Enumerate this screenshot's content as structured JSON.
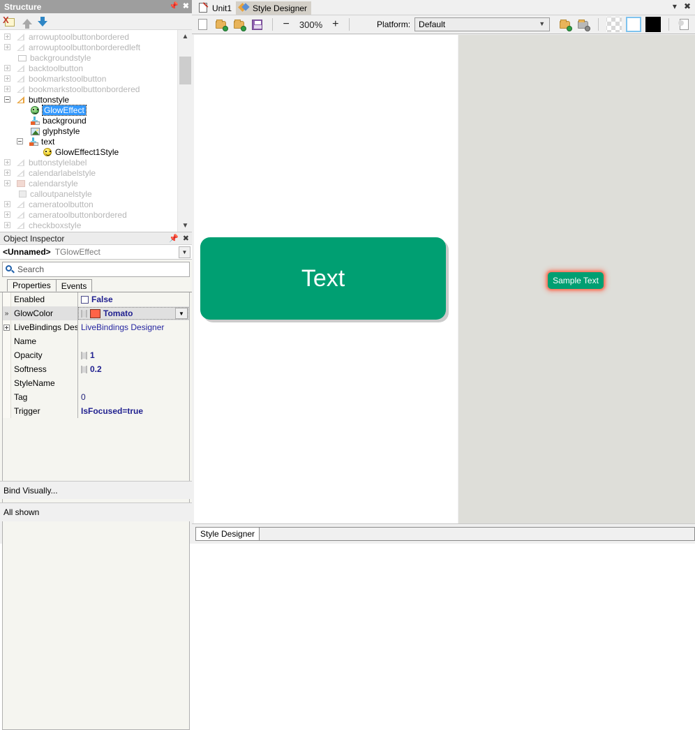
{
  "structure_panel": {
    "title": "Structure",
    "pin_icon": "pin-icon",
    "close_icon": "close-icon",
    "toolbar": [
      {
        "name": "delete-icon",
        "label": ""
      },
      {
        "name": "move-up-icon",
        "label": ""
      },
      {
        "name": "move-down-icon",
        "label": ""
      }
    ],
    "tree": [
      {
        "label": "arrowuptoolbuttonbordered",
        "indent": 1,
        "expander": "plus",
        "icon": "style-icon",
        "state": "dim"
      },
      {
        "label": "arrowuptoolbuttonborderedleft",
        "indent": 1,
        "expander": "plus",
        "icon": "style-icon",
        "state": "dim"
      },
      {
        "label": "backgroundstyle",
        "indent": 1,
        "expander": "none",
        "icon": "rect-icon",
        "state": "dim"
      },
      {
        "label": "backtoolbutton",
        "indent": 1,
        "expander": "plus",
        "icon": "style-icon",
        "state": "dim"
      },
      {
        "label": "bookmarkstoolbutton",
        "indent": 1,
        "expander": "plus",
        "icon": "style-icon",
        "state": "dim"
      },
      {
        "label": "bookmarkstoolbuttonbordered",
        "indent": 1,
        "expander": "plus",
        "icon": "style-icon",
        "state": "dim"
      },
      {
        "label": "buttonstyle",
        "indent": 1,
        "expander": "minus",
        "icon": "style-icon",
        "state": "dark"
      },
      {
        "label": "GlowEffect",
        "indent": 2,
        "expander": "none",
        "icon": "smiley-green-icon",
        "state": "selected"
      },
      {
        "label": "background",
        "indent": 2,
        "expander": "none",
        "icon": "brush-icon",
        "state": "dark"
      },
      {
        "label": "glyphstyle",
        "indent": 2,
        "expander": "none",
        "icon": "image-icon",
        "state": "dark"
      },
      {
        "label": "text",
        "indent": 2,
        "expander": "minus",
        "icon": "brush-icon",
        "state": "dark"
      },
      {
        "label": "GlowEffect1Style",
        "indent": 3,
        "expander": "none",
        "icon": "smiley-yellow-icon",
        "state": "dark"
      },
      {
        "label": "buttonstylelabel",
        "indent": 1,
        "expander": "plus",
        "icon": "style-icon",
        "state": "dim"
      },
      {
        "label": "calendarlabelstyle",
        "indent": 1,
        "expander": "plus",
        "icon": "style-icon",
        "state": "dim"
      },
      {
        "label": "calendarstyle",
        "indent": 1,
        "expander": "plus",
        "icon": "calendar-icon",
        "state": "dim"
      },
      {
        "label": "calloutpanelstyle",
        "indent": 1,
        "expander": "none",
        "icon": "panel-icon",
        "state": "dim"
      },
      {
        "label": "cameratoolbutton",
        "indent": 1,
        "expander": "plus",
        "icon": "style-icon",
        "state": "dim"
      },
      {
        "label": "cameratoolbuttonbordered",
        "indent": 1,
        "expander": "plus",
        "icon": "style-icon",
        "state": "dim"
      },
      {
        "label": "checkboxstyle",
        "indent": 1,
        "expander": "plus",
        "icon": "style-icon",
        "state": "dim"
      }
    ],
    "scroll_up_icon": "chevron-up-icon",
    "scroll_down_icon": "chevron-down-icon"
  },
  "object_inspector": {
    "title": "Object Inspector",
    "pin_icon": "pin-icon",
    "close_icon": "close-icon",
    "object_name": "<Unnamed>",
    "object_type": "TGlowEffect",
    "search_placeholder": "Search",
    "search_icon": "search-icon",
    "tabs": [
      {
        "label": "Properties",
        "active": true
      },
      {
        "label": "Events",
        "active": false
      }
    ],
    "properties": [
      {
        "name": "Enabled",
        "value": "False",
        "kind": "checkbox",
        "gutter": "",
        "selected": false
      },
      {
        "name": "GlowColor",
        "value": "Tomato",
        "kind": "color",
        "gutter": "»",
        "selected": true
      },
      {
        "name": "LiveBindings Desig",
        "value": "LiveBindings Designer",
        "kind": "link",
        "gutter": "+",
        "selected": false
      },
      {
        "name": "Name",
        "value": "",
        "kind": "text",
        "gutter": "",
        "selected": false
      },
      {
        "name": "Opacity",
        "value": "1",
        "kind": "animatable",
        "gutter": "",
        "selected": false
      },
      {
        "name": "Softness",
        "value": "0.2",
        "kind": "animatable",
        "gutter": "",
        "selected": false
      },
      {
        "name": "StyleName",
        "value": "",
        "kind": "text",
        "gutter": "",
        "selected": false
      },
      {
        "name": "Tag",
        "value": "0",
        "kind": "plain",
        "gutter": "",
        "selected": false
      },
      {
        "name": "Trigger",
        "value": "IsFocused=true",
        "kind": "text",
        "gutter": "",
        "selected": false
      }
    ],
    "glow_color_hex": "#FF6347",
    "bind_visually_label": "Bind Visually...",
    "status_label": "All shown"
  },
  "document_tabs": [
    {
      "label": "Unit1",
      "icon": "unit-file-icon",
      "active": false
    },
    {
      "label": "Style Designer",
      "icon": "style-designer-icon",
      "active": true
    }
  ],
  "tab_controls": {
    "collapse_icon": "chevron-down-icon",
    "close_icon": "close-icon"
  },
  "designer_toolbar": {
    "new_label": "",
    "buttons": [
      {
        "name": "new-style-button",
        "icon": "new-page-icon"
      },
      {
        "name": "open-style-button",
        "icon": "open-folder-icon"
      },
      {
        "name": "add-to-style-button",
        "icon": "folder-add-icon"
      },
      {
        "name": "save-style-button",
        "icon": "save-icon"
      }
    ],
    "zoom_out_label": "−",
    "zoom_value": "300%",
    "zoom_in_label": "+",
    "platform_label": "Platform:",
    "platform_value": "Default",
    "platform_options": [
      "Default"
    ],
    "right_buttons": [
      {
        "name": "add-platform-button",
        "icon": "folder-add-icon"
      },
      {
        "name": "delete-platform-button",
        "icon": "folder-delete-icon"
      },
      {
        "name": "transparent-background-button",
        "icon": "checker-icon"
      },
      {
        "name": "white-background-button",
        "icon": "white-square-icon",
        "selected": true
      },
      {
        "name": "black-background-button",
        "icon": "black-square-icon"
      },
      {
        "name": "export-style-button",
        "icon": "export-icon"
      }
    ]
  },
  "design_canvas": {
    "button_text": "Text",
    "button_color": "#009F72",
    "button_text_color": "#FFFFFF"
  },
  "preview_pane": {
    "sample_label": "Sample Text",
    "sample_color": "#009F72",
    "glow_color": "#FF6347",
    "background": "#DEDED9"
  },
  "bottom_tabs": [
    {
      "label": "Style Designer",
      "active": true
    }
  ]
}
